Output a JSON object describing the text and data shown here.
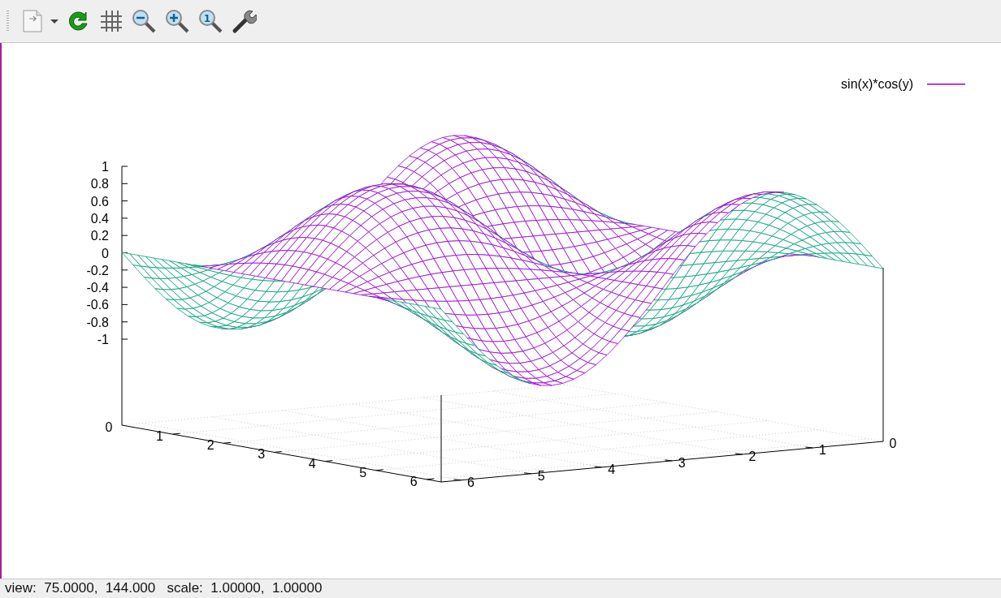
{
  "toolbar": {
    "buttons": [
      {
        "kind": "export"
      },
      {
        "kind": "replot"
      },
      {
        "kind": "grid"
      },
      {
        "kind": "zoom-out"
      },
      {
        "kind": "zoom-in"
      },
      {
        "kind": "zoom-reset",
        "glyph": "1"
      },
      {
        "kind": "settings"
      }
    ]
  },
  "plot": {
    "legend": {
      "label": "sin(x)*cos(y)",
      "color": "#9400d3"
    },
    "z_ticks": [
      "1",
      "0.8",
      "0.6",
      "0.4",
      "0.2",
      "0",
      "-0.2",
      "-0.4",
      "-0.6",
      "-0.8",
      "-1"
    ],
    "x_ticks": [
      "0",
      "1",
      "2",
      "3",
      "4",
      "5",
      "6"
    ],
    "y_ticks": [
      "0",
      "1",
      "2",
      "3",
      "4",
      "5",
      "6"
    ]
  },
  "status_bar": {
    "text": "view:  75.0000,  144.000   scale:  1.00000,  1.00000"
  }
}
